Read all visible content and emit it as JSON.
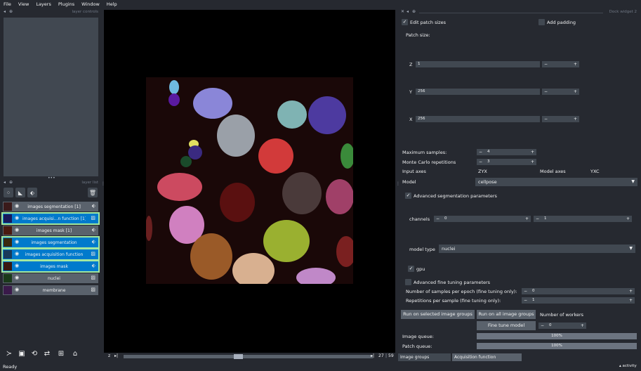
{
  "menu": [
    "File",
    "View",
    "Layers",
    "Plugins",
    "Window",
    "Help"
  ],
  "left_dock": {
    "layer_controls_title": "layer controls",
    "layer_list_title": "layer list"
  },
  "layers": [
    {
      "name": "images segmentation [1]",
      "type": "labels",
      "selected": false,
      "highlighted": false
    },
    {
      "name": "images acquisi...n function [1]",
      "type": "image",
      "selected": true,
      "highlighted": true
    },
    {
      "name": "images mask [1]",
      "type": "labels",
      "selected": false,
      "highlighted": false
    },
    {
      "name": "images segmentation",
      "type": "labels",
      "selected": true,
      "highlighted": true
    },
    {
      "name": "images acquisition function",
      "type": "image",
      "selected": true,
      "highlighted": true
    },
    {
      "name": "images mask",
      "type": "labels",
      "selected": true,
      "highlighted": true
    },
    {
      "name": "nuclei",
      "type": "image",
      "selected": false,
      "highlighted": false
    },
    {
      "name": "membrane",
      "type": "image",
      "selected": false,
      "highlighted": false
    }
  ],
  "canvas": {
    "slider_axis": "z",
    "slider_value": "27",
    "slider_max": "59"
  },
  "status": {
    "text": "Ready",
    "activity": "activity"
  },
  "dock": {
    "title": "Dock widget 2",
    "edit_patch_sizes": {
      "label": "Edit patch sizes",
      "checked": true
    },
    "add_padding": {
      "label": "Add padding",
      "checked": false
    },
    "patch_size_label": "Patch size:",
    "patch_z": {
      "label": "Z",
      "value": "1"
    },
    "patch_y": {
      "label": "Y",
      "value": "256"
    },
    "patch_x": {
      "label": "X",
      "value": "256"
    },
    "max_samples": {
      "label": "Maximum samples:",
      "value": "4"
    },
    "mc_reps": {
      "label": "Monte Carlo repetitions",
      "value": "3"
    },
    "input_axes_label": "Input axes",
    "input_axes_value": "ZYX",
    "model_axes_label": "Model axes",
    "model_axes_value": "YXC",
    "model_label": "Model",
    "model_value": "cellpose",
    "adv_seg": {
      "label": "Advanced segmentation parameters",
      "checked": true
    },
    "channels_label": "channels",
    "channel_1": "0",
    "channel_2": "1",
    "model_type_label": "model type",
    "model_type_value": "nuclei",
    "gpu": {
      "label": "gpu",
      "checked": true
    },
    "adv_ft": {
      "label": "Advanced fine tuning parameters",
      "checked": false
    },
    "samples_per_epoch": {
      "label": "Number of samples per epoch (fine tuning only):",
      "value": "0"
    },
    "reps_per_sample": {
      "label": "Repetitions per sample (fine tuning only):",
      "value": "1"
    },
    "run_selected": "Run on selected image groups",
    "run_all": "Run on all image groups",
    "workers_label": "Number of workers",
    "fine_tune": "Fine tune model",
    "workers_value": "0",
    "image_queue_label": "Image queue:",
    "image_queue_value": "100%",
    "image_queue_fraction": 1.0,
    "patch_queue_label": "Patch queue:",
    "patch_queue_value": "100%",
    "patch_queue_fraction": 1.0
  },
  "tabs": [
    "Image groups manager",
    "Acquisition function configuration"
  ],
  "colors": {
    "bg": "#262930",
    "panel": "#414851",
    "button": "#5a626c",
    "selected": "#007acc",
    "highlight": "#a3e8a0"
  }
}
